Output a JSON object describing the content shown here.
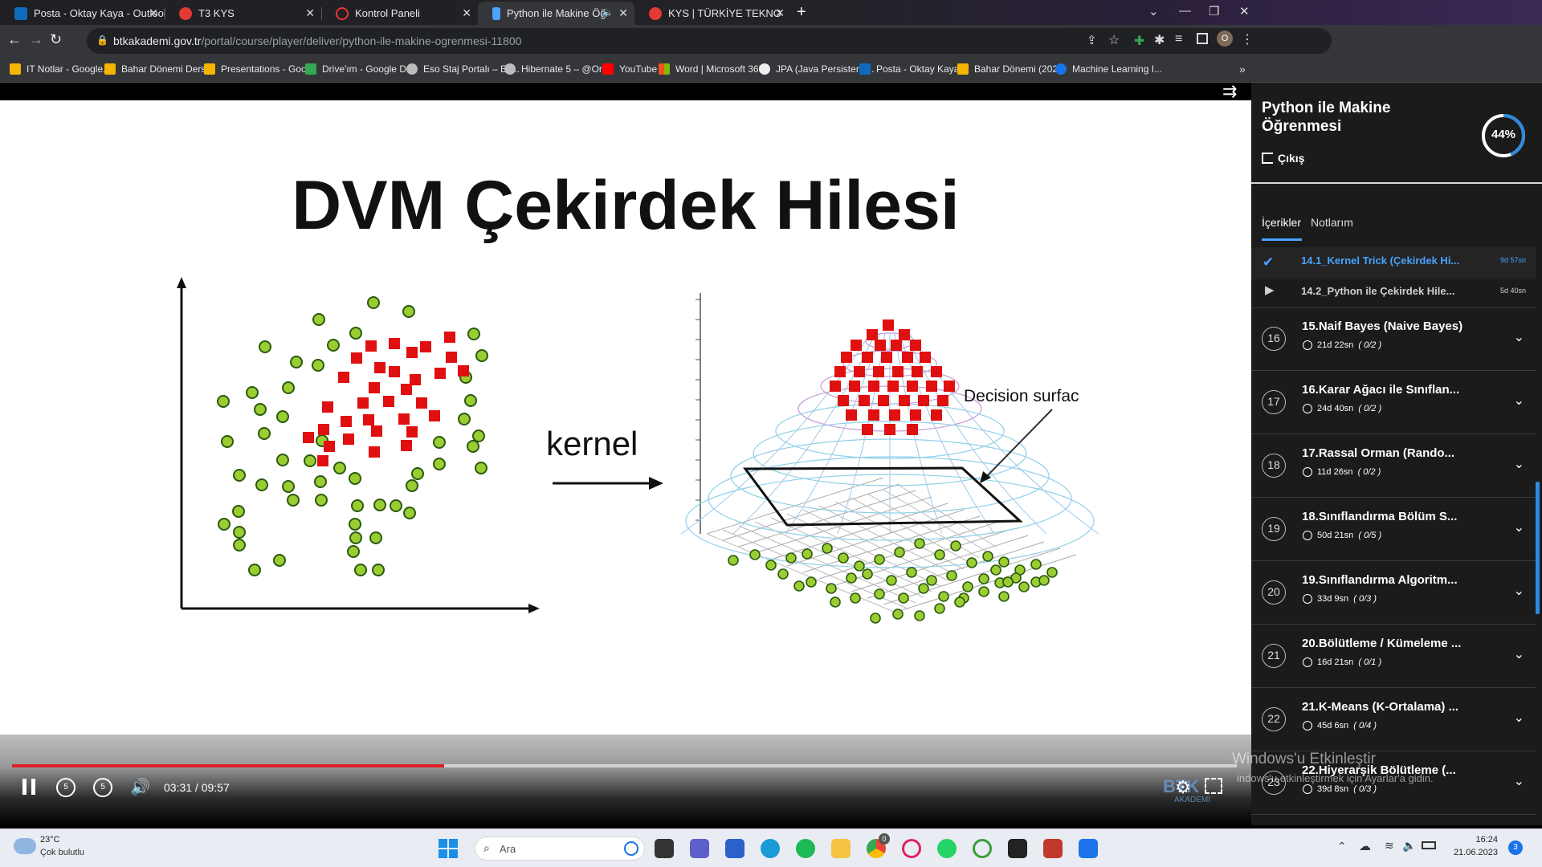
{
  "browser": {
    "tabs": [
      {
        "title": "Posta - Oktay Kaya - Outlook",
        "icon": "outlook-icon",
        "color": "#0f6cbd"
      },
      {
        "title": "T3 KYS",
        "icon": "t3-icon",
        "color": "#e53935"
      },
      {
        "title": "Kontrol Paneli",
        "icon": "kontrol-paneli-icon",
        "color": "#e53935"
      },
      {
        "title": "Python ile Makine Öğrenmesi",
        "icon": "btk-icon",
        "color": "#4aa3ff"
      },
      {
        "title": "KYS | TÜRKİYE TEKNOLOJİ TAKIMI",
        "icon": "t3-icon",
        "color": "#e53935"
      }
    ],
    "url_host": "btkakademi.gov.tr",
    "url_path": "/portal/course/player/deliver/python-ile-makine-ogrenmesi-11800",
    "profile_initial": "O",
    "bookmarks": [
      {
        "label": "IT Notlar - Google...",
        "color": "#f4b400"
      },
      {
        "label": "Bahar Dönemi Ders...",
        "color": "#f4b400"
      },
      {
        "label": "Presentations - Goo...",
        "color": "#f4b400"
      },
      {
        "label": "Drive'ım - Google D...",
        "color": "#34a853"
      },
      {
        "label": "Eso Staj Portalı – Es...",
        "color": "#bbbbbb"
      },
      {
        "label": "Hibernate 5 – @On...",
        "color": "#bbbbbb"
      },
      {
        "label": "YouTube",
        "color": "#ff0000"
      },
      {
        "label": "Word | Microsoft 365",
        "color": "#f25022"
      },
      {
        "label": "JPA (Java Persistenc...",
        "color": "#eeeeee"
      },
      {
        "label": "Posta - Oktay Kaya...",
        "color": "#0f6cbd"
      },
      {
        "label": "Bahar Dönemi (202...",
        "color": "#f4b400"
      },
      {
        "label": "Machine Learning I...",
        "color": "#1a73e8"
      }
    ]
  },
  "slide": {
    "title": "DVM Çekirdek Hilesi",
    "arrow_label": "kernel",
    "surface_label": "Decision surfac"
  },
  "player": {
    "time_current": "03:31",
    "time_sep": " / ",
    "time_total": "09:57",
    "progress_fraction": 0.353,
    "skip_back_seconds": "5",
    "skip_forward_seconds": "5",
    "logo_text": "AKADEMİ"
  },
  "sidebar": {
    "course_title": "Python ile Makine Öğrenmesi",
    "exit_label": "Çıkış",
    "progress_percent": "44%",
    "progress_value": 0.44,
    "tabs": [
      "İçerikler",
      "Notlarım"
    ],
    "lessons": [
      {
        "title": "14.1_Kernel Trick (Çekirdek Hi...",
        "duration": "9d 57sn",
        "state": "completed",
        "color": "#4aa3ff"
      },
      {
        "title": "14.2_Python ile Çekirdek Hile...",
        "duration": "5d 40sn",
        "state": "play",
        "color": "#cfcfcf"
      }
    ],
    "sections": [
      {
        "num": "16",
        "title": "15.Naif Bayes (Naive Bayes)",
        "duration": "21d 22sn",
        "count": "( 0/2 )"
      },
      {
        "num": "17",
        "title": "16.Karar Ağacı ile Sınıflan...",
        "duration": "24d 40sn",
        "count": "( 0/2 )"
      },
      {
        "num": "18",
        "title": "17.Rassal Orman (Rando...",
        "duration": "11d 26sn",
        "count": "( 0/2 )"
      },
      {
        "num": "19",
        "title": "18.Sınıflandırma Bölüm S...",
        "duration": "50d 21sn",
        "count": "( 0/5 )"
      },
      {
        "num": "20",
        "title": "19.Sınıflandırma Algoritm...",
        "duration": "33d 9sn",
        "count": "( 0/3 )"
      },
      {
        "num": "21",
        "title": "20.Bölütleme / Kümeleme ...",
        "duration": "16d 21sn",
        "count": "( 0/1 )"
      },
      {
        "num": "22",
        "title": "21.K-Means (K-Ortalama) ...",
        "duration": "45d 6sn",
        "count": "( 0/4 )"
      },
      {
        "num": "23",
        "title": "22.Hiyerarşik Bölütleme (...",
        "duration": "39d 8sn",
        "count": "( 0/3 )"
      }
    ]
  },
  "windows_watermark": {
    "line1": "Windows'u Etkinleştir",
    "line2": "indows'u etkinleştirmek için Ayarlar'a gidin."
  },
  "taskbar": {
    "weather_temp": "23°C",
    "weather_desc": "Çok bulutlu",
    "search_placeholder": "Ara",
    "chrome_badge": "0",
    "time": "16:24",
    "date": "21.06.2023",
    "notification_count": "3"
  }
}
